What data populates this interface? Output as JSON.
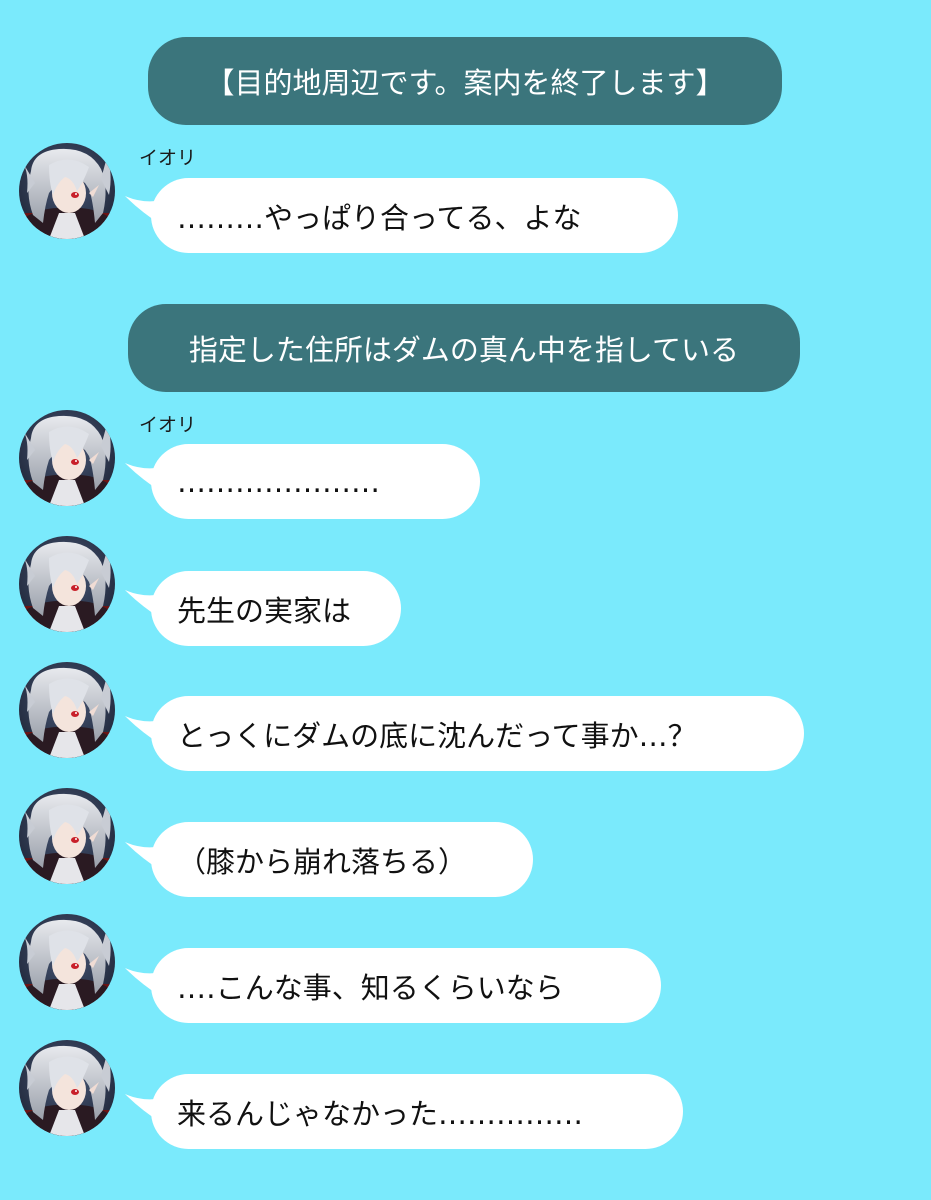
{
  "chat": {
    "system_messages": [
      "【目的地周辺です。案内を終了します】",
      "指定した住所はダムの真ん中を指している"
    ],
    "sender_name": "イオリ",
    "messages": [
      "………やっぱり合ってる、よな",
      "…………………",
      "先生の実家は",
      "とっくにダムの底に沈んだって事か…？",
      "（膝から崩れ落ちる）",
      "‥‥こんな事、知るくらいなら",
      "来るんじゃなかった……………"
    ]
  },
  "colors": {
    "background": "#7aeafc",
    "system_bubble": "#3b757c",
    "message_bubble": "#ffffff"
  },
  "icons": {
    "avatar": "character-avatar-icon",
    "tail": "bubble-tail-icon"
  }
}
